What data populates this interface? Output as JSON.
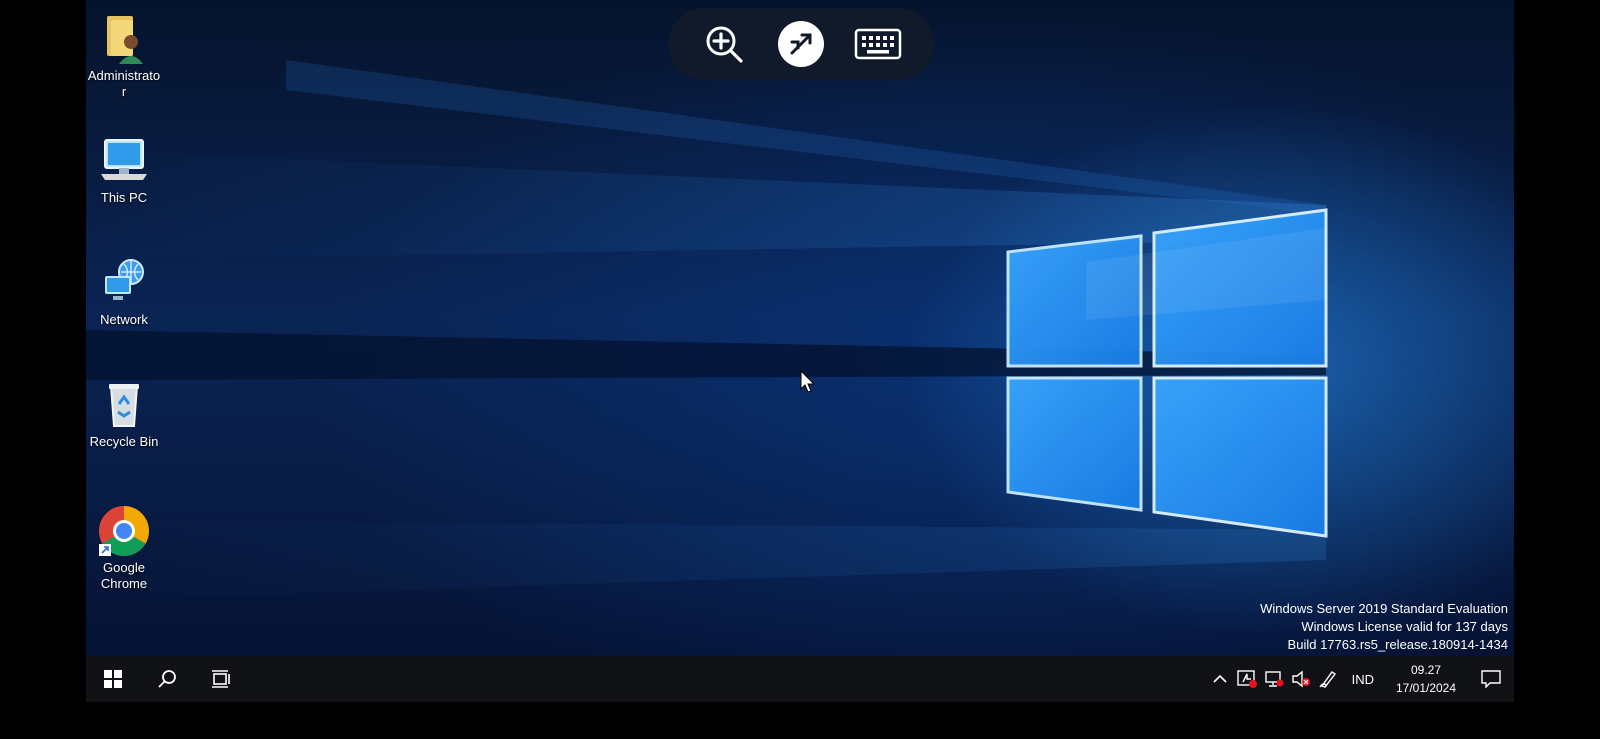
{
  "desktop": {
    "icons": [
      {
        "label": "Administrato\nr",
        "icon": "user-folder-icon"
      },
      {
        "label": "This PC",
        "icon": "computer-icon"
      },
      {
        "label": "Network",
        "icon": "network-globe-icon"
      },
      {
        "label": "Recycle Bin",
        "icon": "recycle-bin-icon"
      },
      {
        "label": "Google\nChrome",
        "icon": "chrome-icon"
      }
    ]
  },
  "rdp_toolbar": {
    "buttons": [
      "zoom-in-icon",
      "remote-desktop-icon",
      "keyboard-icon"
    ]
  },
  "watermark": {
    "line1": "Windows Server 2019 Standard Evaluation",
    "line2": "Windows License valid for 137 days",
    "line3": "Build 17763.rs5_release.180914-1434"
  },
  "taskbar": {
    "language": "IND",
    "time": "09.27",
    "date": "17/01/2024",
    "tray_icons": [
      "chevron-up-icon",
      "flash-icon",
      "network-disconnected-icon",
      "volume-muted-icon",
      "pen-icon"
    ]
  },
  "colors": {
    "taskbar": "#101216",
    "accent_blue": "#2a8cff"
  }
}
